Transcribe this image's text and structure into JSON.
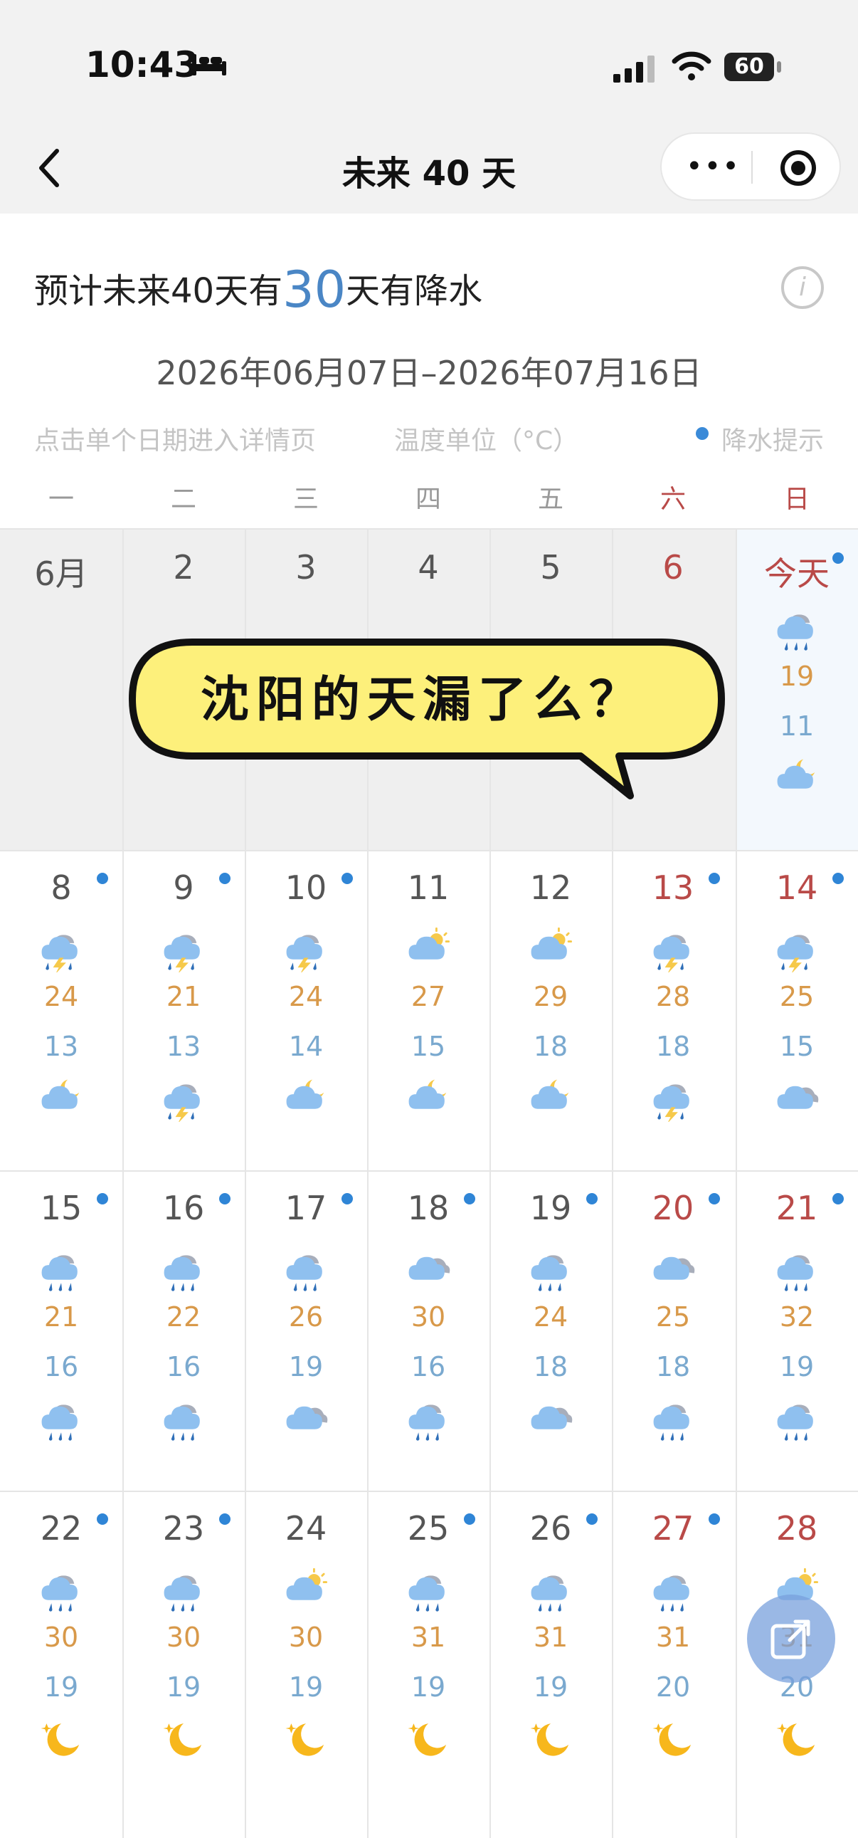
{
  "status_bar": {
    "time": "10:43",
    "battery": "60"
  },
  "nav": {
    "title": "未来 40 天",
    "more_label": "•••"
  },
  "summary": {
    "prefix": "预计未来40天有",
    "count": "30",
    "suffix": "天有降水"
  },
  "date_range": "2026年06月07日–2026年07月16日",
  "hints": {
    "tap": "点击单个日期进入详情页",
    "unit": "温度单位（°C）",
    "rain": "降水提示"
  },
  "weekdays": [
    "一",
    "二",
    "三",
    "四",
    "五",
    "六",
    "日"
  ],
  "overlay": {
    "sticker_text": "沈阳的天漏了么？"
  },
  "week0": [
    {
      "day": "6月",
      "rain": false,
      "hi": "",
      "lo": "",
      "icon_day": "",
      "icon_night": ""
    },
    {
      "day": "2",
      "rain": false,
      "hi": "",
      "lo": "",
      "icon_day": "",
      "icon_night": ""
    },
    {
      "day": "3",
      "rain": false,
      "hi": "",
      "lo": "",
      "icon_day": "",
      "icon_night": ""
    },
    {
      "day": "4",
      "rain": false,
      "hi": "",
      "lo": "",
      "icon_day": "",
      "icon_night": ""
    },
    {
      "day": "5",
      "rain": false,
      "hi": "",
      "lo": "",
      "icon_day": "",
      "icon_night": ""
    },
    {
      "day": "6",
      "rain": false,
      "hi": "",
      "lo": "",
      "icon_day": "",
      "icon_night": ""
    },
    {
      "day": "今天",
      "rain": true,
      "hi": "19",
      "lo": "11",
      "icon_day": "rain-icon",
      "icon_night": "moon-cloud-icon"
    }
  ],
  "week1": [
    {
      "day": "8",
      "rain": true,
      "hi": "24",
      "lo": "13",
      "icon_day": "thunder-icon",
      "icon_night": "moon-cloud-icon"
    },
    {
      "day": "9",
      "rain": true,
      "hi": "21",
      "lo": "13",
      "icon_day": "thunder-icon",
      "icon_night": "thunder-icon"
    },
    {
      "day": "10",
      "rain": true,
      "hi": "24",
      "lo": "14",
      "icon_day": "thunder-icon",
      "icon_night": "moon-cloud-icon"
    },
    {
      "day": "11",
      "rain": false,
      "hi": "27",
      "lo": "15",
      "icon_day": "sun-cloud-icon",
      "icon_night": "moon-cloud-icon"
    },
    {
      "day": "12",
      "rain": false,
      "hi": "29",
      "lo": "18",
      "icon_day": "sun-cloud-icon",
      "icon_night": "moon-cloud-icon"
    },
    {
      "day": "13",
      "rain": true,
      "hi": "28",
      "lo": "18",
      "icon_day": "thunder-icon",
      "icon_night": "thunder-icon"
    },
    {
      "day": "14",
      "rain": true,
      "hi": "25",
      "lo": "15",
      "icon_day": "thunder-icon",
      "icon_night": "cloudy-icon"
    }
  ],
  "week2": [
    {
      "day": "15",
      "rain": true,
      "hi": "21",
      "lo": "16",
      "icon_day": "rain-icon",
      "icon_night": "rain-icon"
    },
    {
      "day": "16",
      "rain": true,
      "hi": "22",
      "lo": "16",
      "icon_day": "rain-icon",
      "icon_night": "rain-icon"
    },
    {
      "day": "17",
      "rain": true,
      "hi": "26",
      "lo": "19",
      "icon_day": "rain-icon",
      "icon_night": "cloudy-icon"
    },
    {
      "day": "18",
      "rain": true,
      "hi": "30",
      "lo": "16",
      "icon_day": "cloudy-icon",
      "icon_night": "rain-icon"
    },
    {
      "day": "19",
      "rain": true,
      "hi": "24",
      "lo": "18",
      "icon_day": "rain-icon",
      "icon_night": "cloudy-icon"
    },
    {
      "day": "20",
      "rain": true,
      "hi": "25",
      "lo": "18",
      "icon_day": "cloudy-icon",
      "icon_night": "rain-icon"
    },
    {
      "day": "21",
      "rain": true,
      "hi": "32",
      "lo": "19",
      "icon_day": "rain-icon",
      "icon_night": "rain-icon"
    }
  ],
  "week3": [
    {
      "day": "22",
      "rain": true,
      "hi": "30",
      "lo": "19",
      "icon_day": "rain-icon",
      "icon_night": "moon-icon"
    },
    {
      "day": "23",
      "rain": true,
      "hi": "30",
      "lo": "19",
      "icon_day": "rain-icon",
      "icon_night": "moon-icon"
    },
    {
      "day": "24",
      "rain": false,
      "hi": "30",
      "lo": "19",
      "icon_day": "sun-cloud-icon",
      "icon_night": "moon-icon"
    },
    {
      "day": "25",
      "rain": true,
      "hi": "31",
      "lo": "19",
      "icon_day": "rain-icon",
      "icon_night": "moon-icon"
    },
    {
      "day": "26",
      "rain": true,
      "hi": "31",
      "lo": "19",
      "icon_day": "rain-icon",
      "icon_night": "moon-icon"
    },
    {
      "day": "27",
      "rain": true,
      "hi": "31",
      "lo": "20",
      "icon_day": "rain-icon",
      "icon_night": "moon-icon"
    },
    {
      "day": "28",
      "rain": false,
      "hi": "31",
      "lo": "20",
      "icon_day": "sun-cloud-icon",
      "icon_night": "moon-icon"
    }
  ],
  "colors": {
    "accent": "#4a86c5",
    "weekend": "#b94a48",
    "high": "#d8994a",
    "low": "#7aa9cf",
    "rain_dot": "#2f85d6"
  }
}
